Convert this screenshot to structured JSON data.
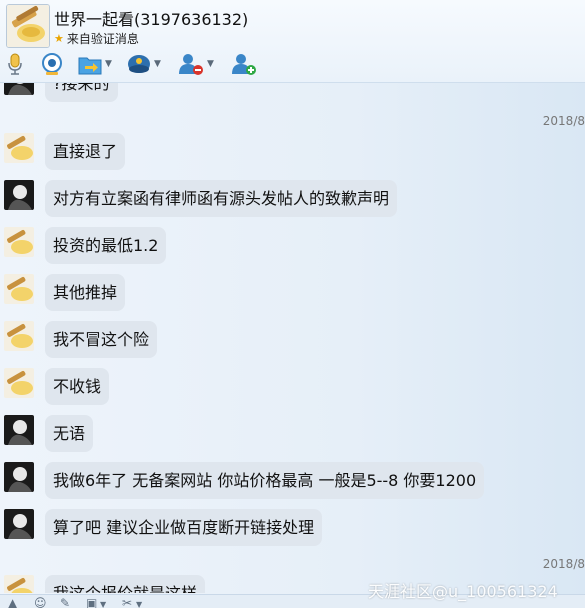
{
  "header": {
    "contact_name": "世界一起看(3197636132)",
    "subtitle": "来自验证消息"
  },
  "toolbar": {
    "icons": [
      "microphone-icon",
      "camera-icon",
      "file-transfer-icon",
      "remote-desktop-icon",
      "remove-contact-icon",
      "add-contact-icon"
    ]
  },
  "messages": [
    {
      "sender": "other",
      "text": "?接来的"
    },
    {
      "sender": "me",
      "text": "直接退了"
    },
    {
      "sender": "other",
      "text": "对方有立案函有律师函有源头发帖人的致歉声明"
    },
    {
      "sender": "me",
      "text": "投资的最低1.2"
    },
    {
      "sender": "me",
      "text": "其他推掉"
    },
    {
      "sender": "me",
      "text": "我不冒这个险"
    },
    {
      "sender": "me",
      "text": "不收钱"
    },
    {
      "sender": "other",
      "text": "无语"
    },
    {
      "sender": "other",
      "text": "我做6年了 无备案网站 你站价格最高 一般是5--8 你要1200"
    },
    {
      "sender": "other",
      "text": "算了吧 建议企业做百度断开链接处理"
    },
    {
      "sender": "me",
      "text": "我这个报价就是这样"
    }
  ],
  "timestamps": [
    "2018/8",
    "2018/8"
  ],
  "watermark": "天涯社区@u_100561324",
  "colors": {
    "bubble": "#dfe6ee",
    "background": "#e9f2fa",
    "header": "#eaf2fa"
  }
}
